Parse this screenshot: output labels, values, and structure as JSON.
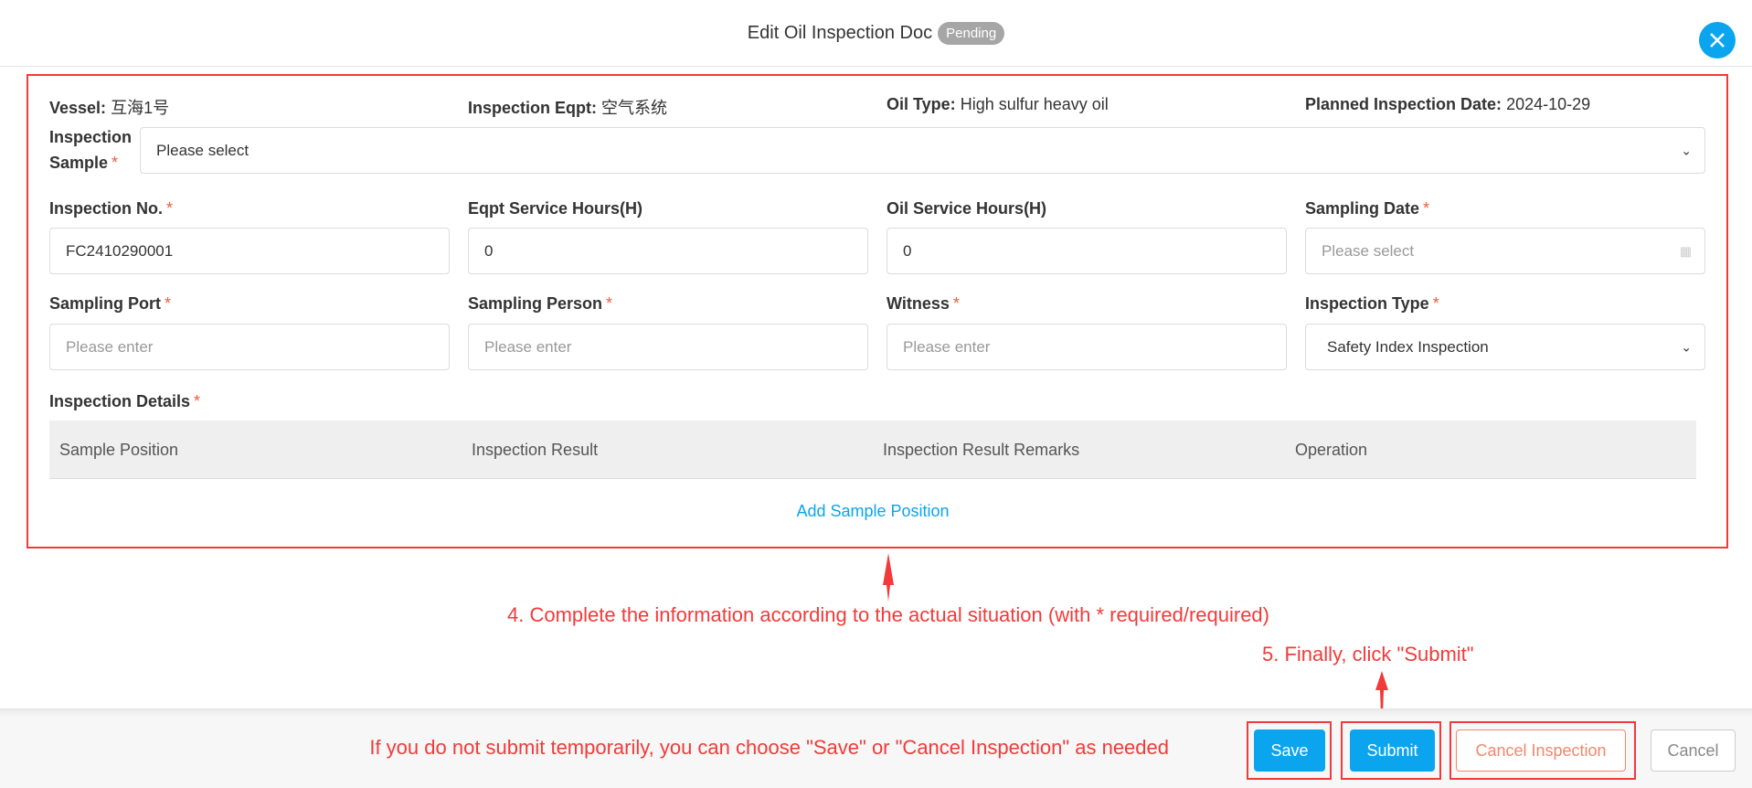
{
  "header": {
    "title": "Edit Oil Inspection Doc",
    "status": "Pending",
    "close_icon": "close-icon"
  },
  "info": {
    "vessel_label": "Vessel:",
    "vessel": "互海1号",
    "eqpt_label": "Inspection Eqpt:",
    "eqpt": "空气系统",
    "oil_label": "Oil Type:",
    "oil": "High sulfur heavy oil",
    "date_label": "Planned Inspection Date:",
    "date": "2024-10-29"
  },
  "form": {
    "sample_label_1": "Inspection",
    "sample_label_2": "Sample",
    "sample_placeholder": "Please select",
    "insp_no_label": "Inspection No.",
    "insp_no": "FC2410290001",
    "eqpt_hours_label": "Eqpt Service Hours(H)",
    "eqpt_hours": "0",
    "oil_hours_label": "Oil Service Hours(H)",
    "oil_hours": "0",
    "sampling_date_label": "Sampling Date",
    "sampling_date_placeholder": "Please select",
    "port_label": "Sampling Port",
    "port_placeholder": "Please enter",
    "person_label": "Sampling Person",
    "person_placeholder": "Please enter",
    "witness_label": "Witness",
    "witness_placeholder": "Please enter",
    "type_label": "Inspection Type",
    "type_value": "Safety Index Inspection",
    "required_mark": "*"
  },
  "details": {
    "label": "Inspection Details",
    "columns": [
      "Sample Position",
      "Inspection Result",
      "Inspection Result Remarks",
      "Operation"
    ],
    "add_link": "Add Sample Position"
  },
  "annotations": {
    "step4": "4. Complete the information according to the actual situation (with * required/required)",
    "step5": "5. Finally, click \"Submit\"",
    "note": "If you do not submit temporarily, you can choose \"Save\" or \"Cancel Inspection\" as needed",
    "color": "#f23a3a"
  },
  "footer": {
    "save": "Save",
    "submit": "Submit",
    "cancel_inspection": "Cancel Inspection",
    "cancel": "Cancel"
  },
  "colors": {
    "accent": "#0aa5ee",
    "danger": "#f2876a"
  }
}
